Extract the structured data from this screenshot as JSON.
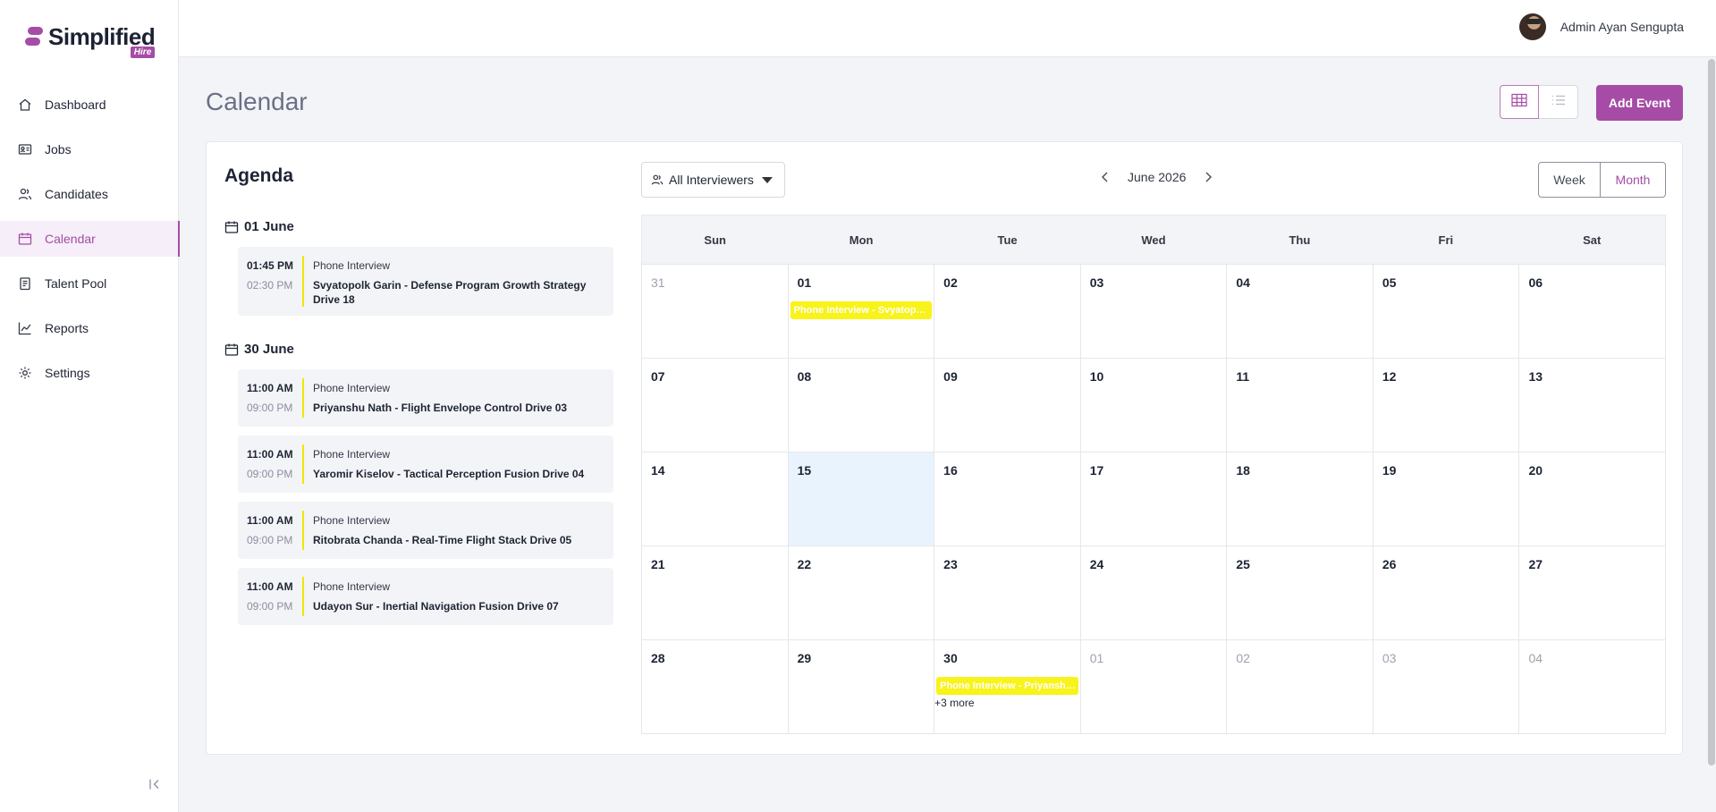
{
  "brand": {
    "name": "Simplified",
    "tag": "Hire",
    "accent": "#a64ca6"
  },
  "sidebar": {
    "items": [
      {
        "label": "Dashboard",
        "icon": "home-icon"
      },
      {
        "label": "Jobs",
        "icon": "id-card-icon"
      },
      {
        "label": "Candidates",
        "icon": "users-icon"
      },
      {
        "label": "Calendar",
        "icon": "calendar-icon",
        "active": true
      },
      {
        "label": "Talent Pool",
        "icon": "clipboard-icon"
      },
      {
        "label": "Reports",
        "icon": "chart-line-icon"
      },
      {
        "label": "Settings",
        "icon": "gear-icon"
      }
    ]
  },
  "header": {
    "user_name": "Admin Ayan Sengupta"
  },
  "page": {
    "title": "Calendar",
    "add_event_label": "Add Event"
  },
  "agenda": {
    "title": "Agenda",
    "groups": [
      {
        "date": "01 June",
        "items": [
          {
            "start": "01:45 PM",
            "end": "02:30 PM",
            "type": "Phone Interview",
            "title": "Svyatopolk Garin - Defense Program Growth Strategy Drive 18"
          }
        ]
      },
      {
        "date": "30 June",
        "items": [
          {
            "start": "11:00 AM",
            "end": "09:00 PM",
            "type": "Phone Interview",
            "title": "Priyanshu Nath - Flight Envelope Control Drive 03"
          },
          {
            "start": "11:00 AM",
            "end": "09:00 PM",
            "type": "Phone Interview",
            "title": "Yaromir Kiselov - Tactical Perception Fusion Drive 04"
          },
          {
            "start": "11:00 AM",
            "end": "09:00 PM",
            "type": "Phone Interview",
            "title": "Ritobrata Chanda - Real-Time Flight Stack Drive 05"
          },
          {
            "start": "11:00 AM",
            "end": "09:00 PM",
            "type": "Phone Interview",
            "title": "Udayon Sur - Inertial Navigation Fusion Drive 07"
          }
        ]
      }
    ]
  },
  "calendar": {
    "filter_label": "All Interviewers",
    "month_label": "June 2026",
    "week_label": "Week",
    "month_button_label": "Month",
    "weekdays": [
      "Sun",
      "Mon",
      "Tue",
      "Wed",
      "Thu",
      "Fri",
      "Sat"
    ],
    "weeks": [
      [
        {
          "d": "31",
          "muted": true
        },
        {
          "d": "01",
          "event": "Phone Interview - Svyatopolk Garin"
        },
        {
          "d": "02"
        },
        {
          "d": "03"
        },
        {
          "d": "04"
        },
        {
          "d": "05"
        },
        {
          "d": "06"
        }
      ],
      [
        {
          "d": "07"
        },
        {
          "d": "08"
        },
        {
          "d": "09"
        },
        {
          "d": "10"
        },
        {
          "d": "11"
        },
        {
          "d": "12"
        },
        {
          "d": "13"
        }
      ],
      [
        {
          "d": "14"
        },
        {
          "d": "15",
          "today": true
        },
        {
          "d": "16"
        },
        {
          "d": "17"
        },
        {
          "d": "18"
        },
        {
          "d": "19"
        },
        {
          "d": "20"
        }
      ],
      [
        {
          "d": "21"
        },
        {
          "d": "22"
        },
        {
          "d": "23"
        },
        {
          "d": "24"
        },
        {
          "d": "25"
        },
        {
          "d": "26"
        },
        {
          "d": "27"
        }
      ],
      [
        {
          "d": "28"
        },
        {
          "d": "29"
        },
        {
          "d": "30",
          "event": "Phone Interview - Priyanshu Nath",
          "more": "+3 more"
        },
        {
          "d": "01",
          "muted": true
        },
        {
          "d": "02",
          "muted": true
        },
        {
          "d": "03",
          "muted": true
        },
        {
          "d": "04",
          "muted": true
        }
      ]
    ],
    "event_color": "#f8f31a",
    "today_color": "#e8f3fd"
  }
}
